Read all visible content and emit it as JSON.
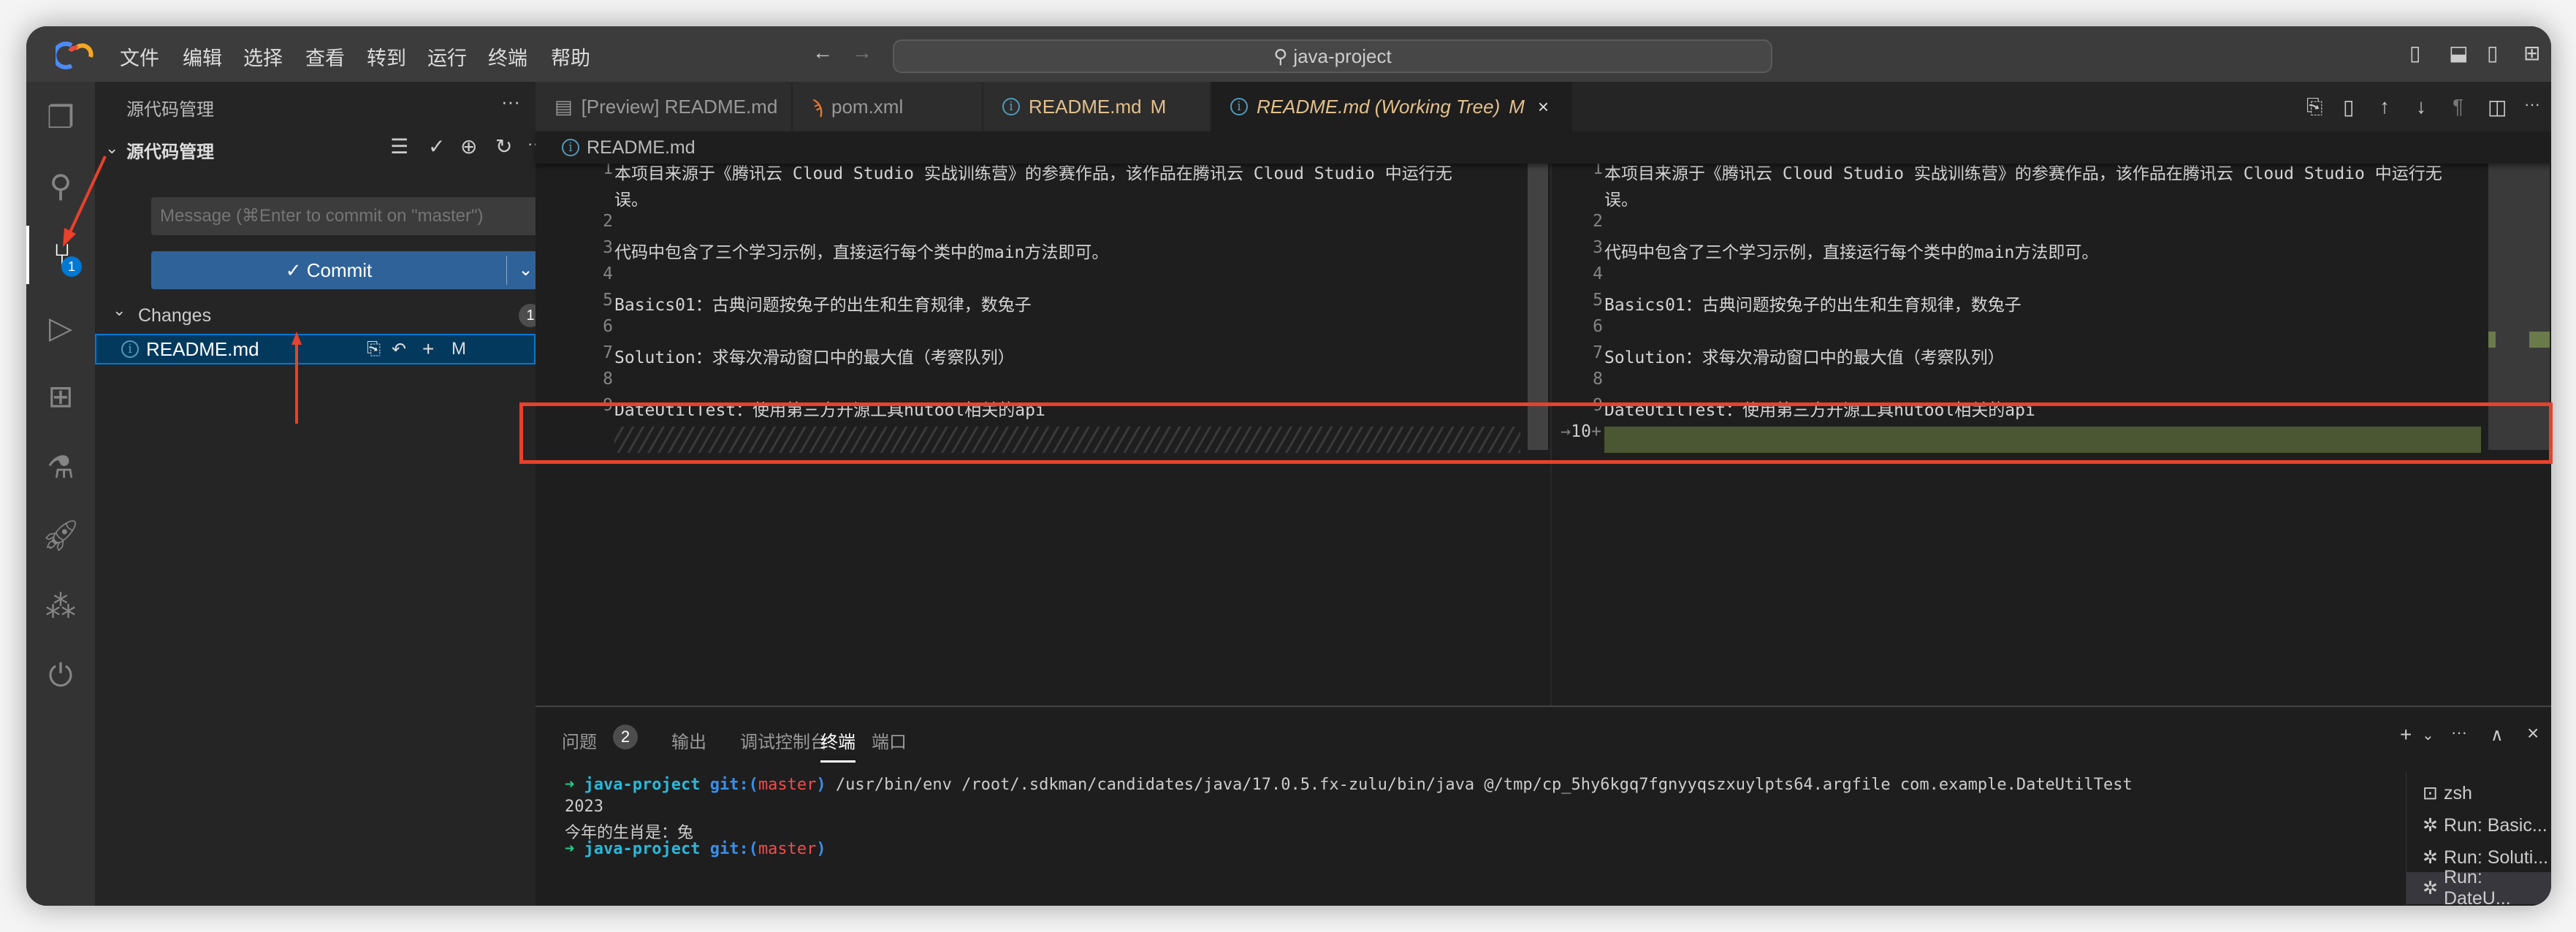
{
  "menu": [
    "文件",
    "编辑",
    "选择",
    "查看",
    "转到",
    "运行",
    "终端",
    "帮助"
  ],
  "search": {
    "text": "java-project"
  },
  "sidebar": {
    "header": "源代码管理",
    "more": "···",
    "section": "源代码管理",
    "message_placeholder": "Message (⌘Enter to commit on \"master\")",
    "commit_label": "Commit",
    "changes_label": "Changes",
    "changes_count": "1",
    "file": {
      "name": "README.md",
      "status": "M"
    }
  },
  "activity": {
    "scm_badge": "1"
  },
  "tabs": [
    {
      "label": "[Preview] README.md"
    },
    {
      "label": "pom.xml"
    },
    {
      "label": "README.md",
      "status": "M"
    },
    {
      "label": "README.md (Working Tree)",
      "status": "M",
      "close": "×"
    }
  ],
  "breadcrumb": "README.md",
  "editor": {
    "lines": [
      {
        "n": "1",
        "text": "本项目来源于《腾讯云 Cloud Studio 实战训练营》的参赛作品，该作品在腾讯云 Cloud Studio 中运行无",
        "cont": "误。"
      },
      {
        "n": "2",
        "text": ""
      },
      {
        "n": "3",
        "text": "代码中包含了三个学习示例，直接运行每个类中的main方法即可。"
      },
      {
        "n": "4",
        "text": ""
      },
      {
        "n": "5",
        "text": "Basics01：古典问题按兔子的出生和生育规律，数兔子"
      },
      {
        "n": "6",
        "text": ""
      },
      {
        "n": "7",
        "text": "Solution：求每次滑动窗口中的最大值（考察队列）"
      },
      {
        "n": "8",
        "text": ""
      },
      {
        "n": "9",
        "text": "DateUtilTest：使用第三方开源工具hutool相关的api"
      }
    ],
    "added_line_number": "10",
    "added_marker": "+",
    "added_color": "#4b5632"
  },
  "panel": {
    "tabs": [
      "问题",
      "输出",
      "调试控制台",
      "终端",
      "端口"
    ],
    "problems_count": "2",
    "terminal": {
      "prompt_dir": "java-project",
      "prompt_git": "git:(",
      "prompt_branch": "master",
      "prompt_close": ")",
      "command": "/usr/bin/env /root/.sdkman/candidates/java/17.0.5.fx-zulu/bin/java @/tmp/cp_5hy6kgq7fgnyyqszxuylpts64.argfile com.example.DateUtilTest",
      "out1": "2023",
      "out2": "今年的生肖是：兔"
    },
    "terminals": [
      "zsh",
      "Run: Basic...",
      "Run: Soluti...",
      "Run: DateU..."
    ]
  },
  "colors": {
    "accent": "#0e639c",
    "annotation": "#e8412c"
  }
}
